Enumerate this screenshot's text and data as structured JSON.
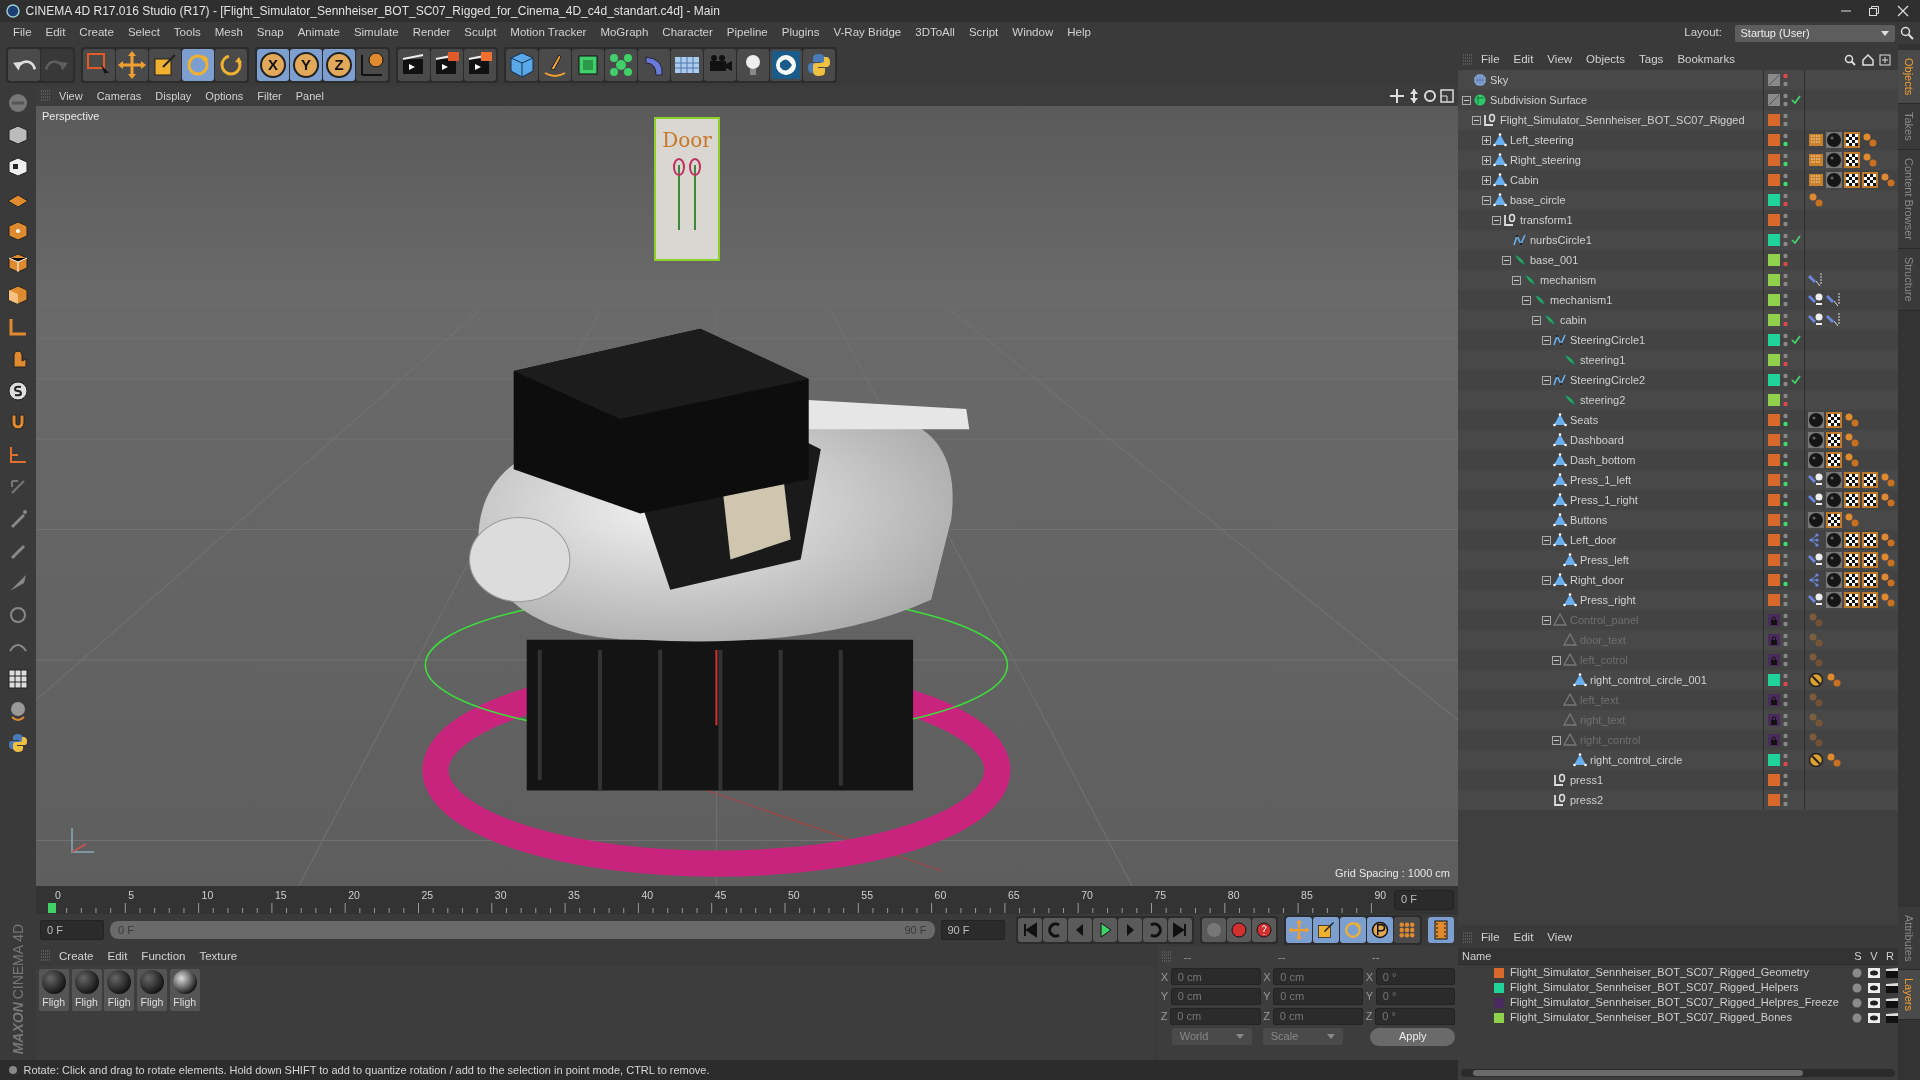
{
  "window": {
    "title": "CINEMA 4D R17.016 Studio (R17) - [Flight_Simulator_Sennheiser_BOT_SC07_Rigged_for_Cinema_4D_c4d_standart.c4d] - Main"
  },
  "menu": [
    "File",
    "Edit",
    "Create",
    "Select",
    "Tools",
    "Mesh",
    "Snap",
    "Animate",
    "Simulate",
    "Render",
    "Sculpt",
    "Motion Tracker",
    "MoGraph",
    "Character",
    "Pipeline",
    "Plugins",
    "V-Ray Bridge",
    "3DToAll",
    "Script",
    "Window",
    "Help"
  ],
  "layout": {
    "label": "Layout:",
    "value": "Startup (User)"
  },
  "toolbar": {
    "history": [
      {
        "kind": "undo",
        "disabled": false
      },
      {
        "kind": "redo",
        "disabled": true
      }
    ],
    "tools": [
      {
        "kind": "selection",
        "selected": false
      },
      {
        "kind": "move",
        "selected": false
      },
      {
        "kind": "scale",
        "selected": false
      },
      {
        "kind": "rotate",
        "selected": true
      },
      {
        "kind": "recent",
        "selected": false
      }
    ],
    "axes": [
      {
        "label": "X",
        "on": true
      },
      {
        "label": "Y",
        "on": true
      },
      {
        "label": "Z",
        "on": true
      }
    ]
  },
  "viewport": {
    "menu": [
      "View",
      "Cameras",
      "Display",
      "Options",
      "Filter",
      "Panel"
    ],
    "camera": "Perspective",
    "door_sign": "Door",
    "grid_spacing": "Grid Spacing : 1000 cm"
  },
  "timeline": {
    "ticks": [
      "0",
      "5",
      "10",
      "15",
      "20",
      "25",
      "30",
      "35",
      "40",
      "45",
      "50",
      "55",
      "60",
      "65",
      "70",
      "75",
      "80",
      "85",
      "90"
    ],
    "current": "0 F"
  },
  "range": {
    "start": "0 F",
    "slider_start": "0 F",
    "slider_end": "90 F",
    "end": "90 F",
    "level": 1
  },
  "materials": {
    "menu": [
      "Create",
      "Edit",
      "Function",
      "Texture"
    ],
    "items": [
      {
        "name": "Fligh"
      },
      {
        "name": "Fligh"
      },
      {
        "name": "Fligh"
      },
      {
        "name": "Fligh"
      },
      {
        "name": "Fligh"
      }
    ]
  },
  "coordinates": {
    "headers": [
      "--",
      "--",
      "--"
    ],
    "rows": [
      [
        {
          "axis": "X",
          "value": "0 cm"
        },
        {
          "axis": "X",
          "value": "0 cm"
        },
        {
          "axis": "X",
          "value": "0 °"
        }
      ],
      [
        {
          "axis": "Y",
          "value": "0 cm"
        },
        {
          "axis": "Y",
          "value": "0 cm"
        },
        {
          "axis": "Y",
          "value": "0 °"
        }
      ],
      [
        {
          "axis": "Z",
          "value": "0 cm"
        },
        {
          "axis": "Z",
          "value": "0 cm"
        },
        {
          "axis": "Z",
          "value": "0 °"
        }
      ]
    ],
    "mode": "World",
    "size_mode": "Scale",
    "apply": "Apply"
  },
  "objects": {
    "menu": [
      "File",
      "Edit",
      "View",
      "Objects",
      "Tags",
      "Bookmarks"
    ],
    "tree": [
      {
        "name": "Sky",
        "kind": "sky",
        "disabled": false,
        "editor_off": true
      },
      {
        "name": "Subdivision Surface",
        "kind": "subdivision",
        "disabled": false,
        "enabled": true,
        "expanded": true,
        "children": [
          {
            "name": "Flight_Simulator_Sennheiser_BOT_SC07_Rigged",
            "kind": "null",
            "color": "#d8692a",
            "disabled": false,
            "expanded": true,
            "children": [
              {
                "name": "Left_steering",
                "kind": "polygon",
                "color": "#d8692a",
                "disabled": false,
                "render_on": true,
                "expanded": false,
                "tags": [
                  {
                    "kind": "uv"
                  },
                  {
                    "kind": "material"
                  },
                  {
                    "kind": "checker"
                  },
                  {
                    "kind": "phong"
                  }
                ]
              },
              {
                "name": "Right_steering",
                "kind": "polygon",
                "color": "#d8692a",
                "disabled": false,
                "render_on": true,
                "expanded": false,
                "tags": [
                  {
                    "kind": "uv"
                  },
                  {
                    "kind": "material"
                  },
                  {
                    "kind": "checker"
                  },
                  {
                    "kind": "phong"
                  }
                ]
              },
              {
                "name": "Cabin",
                "kind": "polygon",
                "color": "#d8692a",
                "disabled": false,
                "render_on": true,
                "expanded": false,
                "tags": [
                  {
                    "kind": "uv"
                  },
                  {
                    "kind": "material"
                  },
                  {
                    "kind": "checker"
                  },
                  {
                    "kind": "checker"
                  },
                  {
                    "kind": "phong"
                  }
                ]
              },
              {
                "name": "base_circle",
                "kind": "polygon",
                "color": "#1fd39a",
                "disabled": false,
                "render_off": true,
                "expanded": true,
                "tags": [
                  {
                    "kind": "phong"
                  }
                ],
                "children": [
                  {
                    "name": "transform1",
                    "kind": "null",
                    "color": "#d8692a",
                    "disabled": false,
                    "expanded": true,
                    "children": [
                      {
                        "name": "nurbsCircle1",
                        "kind": "spline",
                        "color": "#1fd39a",
                        "disabled": false,
                        "enabled": true
                      },
                      {
                        "name": "base_001",
                        "kind": "bone",
                        "color": "#8fd14a",
                        "disabled": false,
                        "render_off": true,
                        "expanded": true,
                        "children": [
                          {
                            "name": "mechanism",
                            "kind": "bone",
                            "color": "#8fd14a",
                            "disabled": false,
                            "expanded": true,
                            "tags": [
                              {
                                "kind": "pin"
                              }
                            ],
                            "children": [
                              {
                                "name": "mechanism1",
                                "kind": "bone",
                                "color": "#8fd14a",
                                "disabled": false,
                                "expanded": true,
                                "tags": [
                                  {
                                    "kind": "pin-goal"
                                  },
                                  {
                                    "kind": "pin"
                                  }
                                ],
                                "children": [
                                  {
                                    "name": "cabin",
                                    "kind": "bone",
                                    "color": "#8fd14a",
                                    "disabled": false,
                                    "render_off": true,
                                    "expanded": true,
                                    "tags": [
                                      {
                                        "kind": "pin-goal"
                                      },
                                      {
                                        "kind": "pin"
                                      }
                                    ],
                                    "children": [
                                      {
                                        "name": "SteeringCircle1",
                                        "kind": "spline",
                                        "color": "#1fd39a",
                                        "disabled": false,
                                        "enabled": true,
                                        "expanded": true,
                                        "children": [
                                          {
                                            "name": "steering1",
                                            "kind": "bone",
                                            "color": "#8fd14a",
                                            "disabled": false,
                                            "render_off": true
                                          }
                                        ]
                                      },
                                      {
                                        "name": "SteeringCircle2",
                                        "kind": "spline",
                                        "color": "#1fd39a",
                                        "disabled": false,
                                        "enabled": true,
                                        "expanded": true,
                                        "children": [
                                          {
                                            "name": "steering2",
                                            "kind": "bone",
                                            "color": "#8fd14a",
                                            "disabled": false,
                                            "render_off": true
                                          }
                                        ]
                                      },
                                      {
                                        "name": "Seats",
                                        "kind": "polygon",
                                        "color": "#d8692a",
                                        "disabled": false,
                                        "render_on": true,
                                        "tags": [
                                          {
                                            "kind": "material"
                                          },
                                          {
                                            "kind": "checker"
                                          },
                                          {
                                            "kind": "phong"
                                          }
                                        ]
                                      },
                                      {
                                        "name": "Dashboard",
                                        "kind": "polygon",
                                        "color": "#d8692a",
                                        "disabled": false,
                                        "render_on": true,
                                        "tags": [
                                          {
                                            "kind": "material"
                                          },
                                          {
                                            "kind": "checker"
                                          },
                                          {
                                            "kind": "phong"
                                          }
                                        ]
                                      },
                                      {
                                        "name": "Dash_bottom",
                                        "kind": "polygon",
                                        "color": "#d8692a",
                                        "disabled": false,
                                        "render_on": true,
                                        "tags": [
                                          {
                                            "kind": "material"
                                          },
                                          {
                                            "kind": "checker"
                                          },
                                          {
                                            "kind": "phong"
                                          }
                                        ]
                                      },
                                      {
                                        "name": "Press_1_left",
                                        "kind": "polygon",
                                        "color": "#d8692a",
                                        "disabled": false,
                                        "render_on": true,
                                        "tags": [
                                          {
                                            "kind": "pin-goal"
                                          },
                                          {
                                            "kind": "material"
                                          },
                                          {
                                            "kind": "checker"
                                          },
                                          {
                                            "kind": "checker"
                                          },
                                          {
                                            "kind": "phong"
                                          }
                                        ]
                                      },
                                      {
                                        "name": "Press_1_right",
                                        "kind": "polygon",
                                        "color": "#d8692a",
                                        "disabled": false,
                                        "render_on": true,
                                        "tags": [
                                          {
                                            "kind": "pin-goal"
                                          },
                                          {
                                            "kind": "material"
                                          },
                                          {
                                            "kind": "checker"
                                          },
                                          {
                                            "kind": "checker"
                                          },
                                          {
                                            "kind": "phong"
                                          }
                                        ]
                                      },
                                      {
                                        "name": "Buttons",
                                        "kind": "polygon",
                                        "color": "#d8692a",
                                        "disabled": false,
                                        "render_on": true,
                                        "tags": [
                                          {
                                            "kind": "material"
                                          },
                                          {
                                            "kind": "checker"
                                          },
                                          {
                                            "kind": "phong"
                                          }
                                        ]
                                      },
                                      {
                                        "name": "Left_door",
                                        "kind": "polygon",
                                        "color": "#d8692a",
                                        "disabled": false,
                                        "render_on": true,
                                        "expanded": true,
                                        "tags": [
                                          {
                                            "kind": "constraint"
                                          },
                                          {
                                            "kind": "material"
                                          },
                                          {
                                            "kind": "checker"
                                          },
                                          {
                                            "kind": "checker"
                                          },
                                          {
                                            "kind": "phong"
                                          }
                                        ],
                                        "children": [
                                          {
                                            "name": "Press_left",
                                            "kind": "polygon",
                                            "color": "#d8692a",
                                            "disabled": false,
                                            "tags": [
                                              {
                                                "kind": "pin-goal"
                                              },
                                              {
                                                "kind": "material"
                                              },
                                              {
                                                "kind": "checker"
                                              },
                                              {
                                                "kind": "checker"
                                              },
                                              {
                                                "kind": "phong"
                                              }
                                            ]
                                          }
                                        ]
                                      },
                                      {
                                        "name": "Right_door",
                                        "kind": "polygon",
                                        "color": "#d8692a",
                                        "disabled": false,
                                        "render_on": true,
                                        "expanded": true,
                                        "tags": [
                                          {
                                            "kind": "constraint"
                                          },
                                          {
                                            "kind": "material"
                                          },
                                          {
                                            "kind": "checker"
                                          },
                                          {
                                            "kind": "checker"
                                          },
                                          {
                                            "kind": "phong"
                                          }
                                        ],
                                        "children": [
                                          {
                                            "name": "Press_right",
                                            "kind": "polygon",
                                            "color": "#d8692a",
                                            "disabled": false,
                                            "tags": [
                                              {
                                                "kind": "pin-goal"
                                              },
                                              {
                                                "kind": "material"
                                              },
                                              {
                                                "kind": "checker"
                                              },
                                              {
                                                "kind": "checker"
                                              },
                                              {
                                                "kind": "phong"
                                              }
                                            ]
                                          }
                                        ]
                                      },
                                      {
                                        "name": "Control_panel",
                                        "kind": "polygon",
                                        "color": "#4a2a5c",
                                        "disabled": true,
                                        "expanded": true,
                                        "tags": [
                                          {
                                            "kind": "phong"
                                          }
                                        ],
                                        "children": [
                                          {
                                            "name": "door_text",
                                            "kind": "polygon",
                                            "color": "#4a2a5c",
                                            "disabled": true,
                                            "tags": [
                                              {
                                                "kind": "phong"
                                              }
                                            ]
                                          },
                                          {
                                            "name": "left_cotrol",
                                            "kind": "polygon",
                                            "color": "#4a2a5c",
                                            "disabled": true,
                                            "expanded": true,
                                            "tags": [
                                              {
                                                "kind": "phong"
                                              }
                                            ],
                                            "children": [
                                              {
                                                "name": "right_control_circle_001",
                                                "kind": "polygon",
                                                "color": "#1fd39a",
                                                "disabled": false,
                                                "render_off": true,
                                                "tags": [
                                                  {
                                                    "kind": "display"
                                                  },
                                                  {
                                                    "kind": "phong"
                                                  }
                                                ]
                                              }
                                            ]
                                          },
                                          {
                                            "name": "left_text",
                                            "kind": "polygon",
                                            "color": "#4a2a5c",
                                            "disabled": true,
                                            "tags": [
                                              {
                                                "kind": "phong"
                                              }
                                            ]
                                          },
                                          {
                                            "name": "right_text",
                                            "kind": "polygon",
                                            "color": "#4a2a5c",
                                            "disabled": true,
                                            "tags": [
                                              {
                                                "kind": "phong"
                                              }
                                            ]
                                          },
                                          {
                                            "name": "right_control",
                                            "kind": "polygon",
                                            "color": "#4a2a5c",
                                            "disabled": true,
                                            "expanded": true,
                                            "tags": [
                                              {
                                                "kind": "phong"
                                              }
                                            ],
                                            "children": [
                                              {
                                                "name": "right_control_circle",
                                                "kind": "polygon",
                                                "color": "#1fd39a",
                                                "disabled": false,
                                                "render_off": true,
                                                "tags": [
                                                  {
                                                    "kind": "display"
                                                  },
                                                  {
                                                    "kind": "phong"
                                                  }
                                                ]
                                              }
                                            ]
                                          }
                                        ]
                                      },
                                      {
                                        "name": "press1",
                                        "kind": "null",
                                        "color": "#d8692a",
                                        "disabled": false
                                      },
                                      {
                                        "name": "press2",
                                        "kind": "null",
                                        "color": "#d8692a",
                                        "disabled": false
                                      }
                                    ]
                                  }
                                ]
                              }
                            ]
                          }
                        ]
                      }
                    ]
                  }
                ]
              }
            ]
          }
        ]
      }
    ]
  },
  "side_tabs": [
    {
      "label": "Objects",
      "selected": true
    },
    {
      "label": "Takes",
      "selected": false
    },
    {
      "label": "Content Browser",
      "selected": false
    },
    {
      "label": "Structure",
      "selected": false
    }
  ],
  "layers": {
    "menu": [
      "File",
      "Edit",
      "View"
    ],
    "columns": [
      "Name",
      "S",
      "V",
      "R"
    ],
    "items": [
      {
        "name": "Flight_Simulator_Sennheiser_BOT_SC07_Rigged_Geometry",
        "color": "#d8692a"
      },
      {
        "name": "Flight_Simulator_Sennheiser_BOT_SC07_Rigged_Helpers",
        "color": "#1fd39a"
      },
      {
        "name": "Flight_Simulator_Sennheiser_BOT_SC07_Rigged_Helpres_Freeze",
        "color": "#4a2a5c"
      },
      {
        "name": "Flight_Simulator_Sennheiser_BOT_SC07_Rigged_Bones",
        "color": "#8fd14a"
      }
    ]
  },
  "bottom_tabs": [
    {
      "label": "Attributes",
      "selected": false
    },
    {
      "label": "Layers",
      "selected": true
    }
  ],
  "logo": {
    "brand": "MAXON",
    "product": "CINEMA 4D"
  },
  "status": "Rotate: Click and drag to rotate elements. Hold down SHIFT to add to quantize rotation / add to the selection in point mode, CTRL to remove."
}
